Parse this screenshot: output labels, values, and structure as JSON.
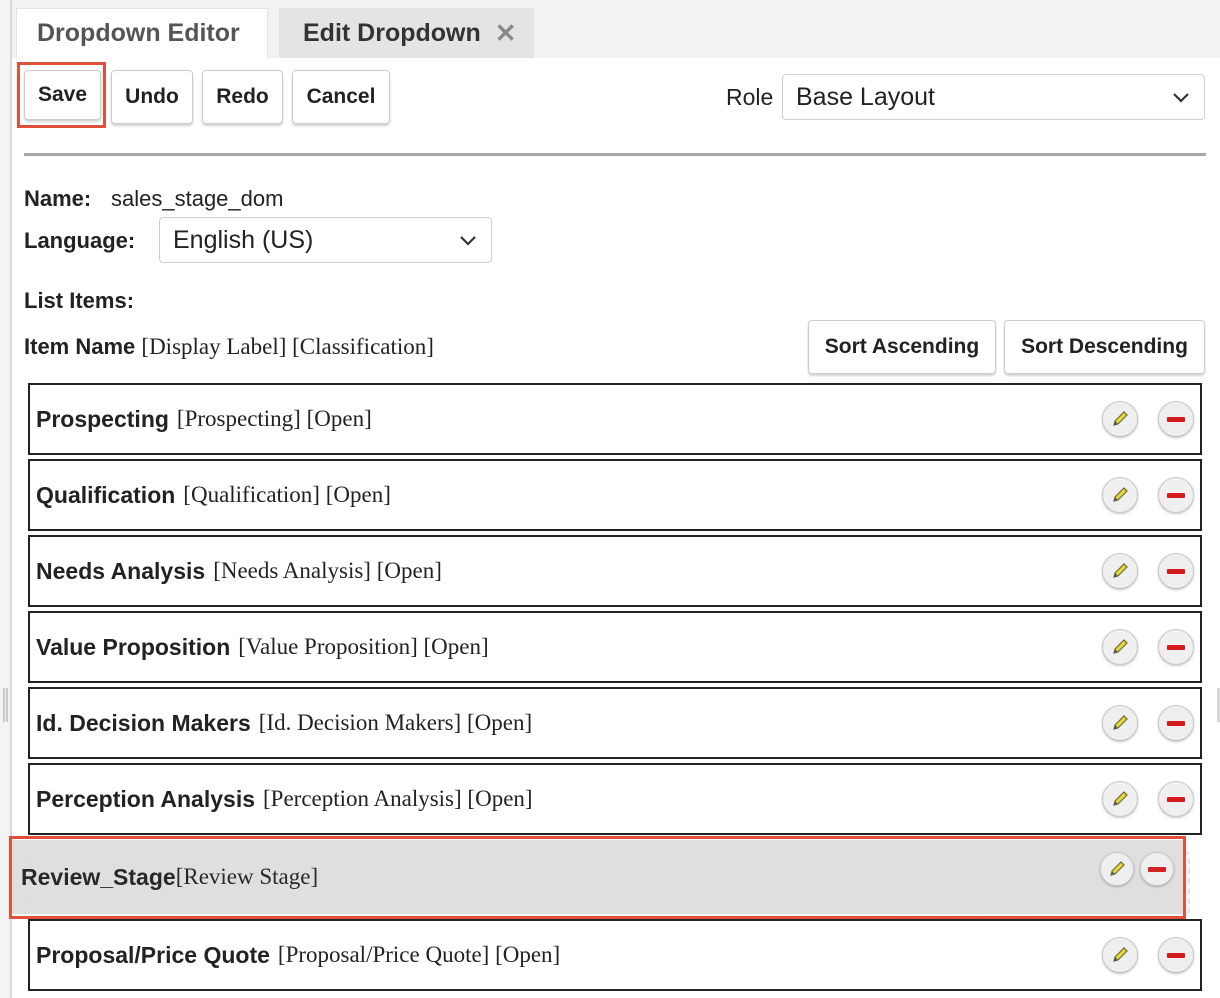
{
  "tabs": [
    {
      "label": "Dropdown Editor",
      "active": true
    },
    {
      "label": "Edit Dropdown",
      "active": false,
      "close_icon": "close-icon"
    }
  ],
  "toolbar": {
    "save_label": "Save",
    "undo_label": "Undo",
    "redo_label": "Redo",
    "cancel_label": "Cancel"
  },
  "role": {
    "label": "Role",
    "selected": "Base Layout"
  },
  "form": {
    "name_label": "Name:",
    "name_value": "sales_stage_dom",
    "language_label": "Language:",
    "language_selected": "English (US)",
    "list_items_label": "List Items:",
    "header_item_name": "Item Name",
    "header_meta": "[Display Label] [Classification]"
  },
  "sort": {
    "ascending_label": "Sort Ascending",
    "descending_label": "Sort Descending"
  },
  "items": [
    {
      "name": "Prospecting",
      "meta": "[Prospecting] [Open]"
    },
    {
      "name": "Qualification",
      "meta": "[Qualification] [Open]"
    },
    {
      "name": "Needs Analysis",
      "meta": "[Needs Analysis] [Open]"
    },
    {
      "name": "Value Proposition",
      "meta": "[Value Proposition] [Open]"
    },
    {
      "name": "Id. Decision Makers",
      "meta": "[Id. Decision Makers] [Open]"
    },
    {
      "name": "Perception Analysis",
      "meta": "[Perception Analysis] [Open]"
    },
    {
      "name": "Proposal/Price Quote",
      "meta": "[Proposal/Price Quote] [Open]"
    }
  ],
  "dragging_item": {
    "name": "Review_Stage",
    "meta": "[Review Stage]"
  },
  "colors": {
    "highlight": "#e0513b",
    "remove": "#d31c1c",
    "edit_pencil": "#e8d53a"
  }
}
